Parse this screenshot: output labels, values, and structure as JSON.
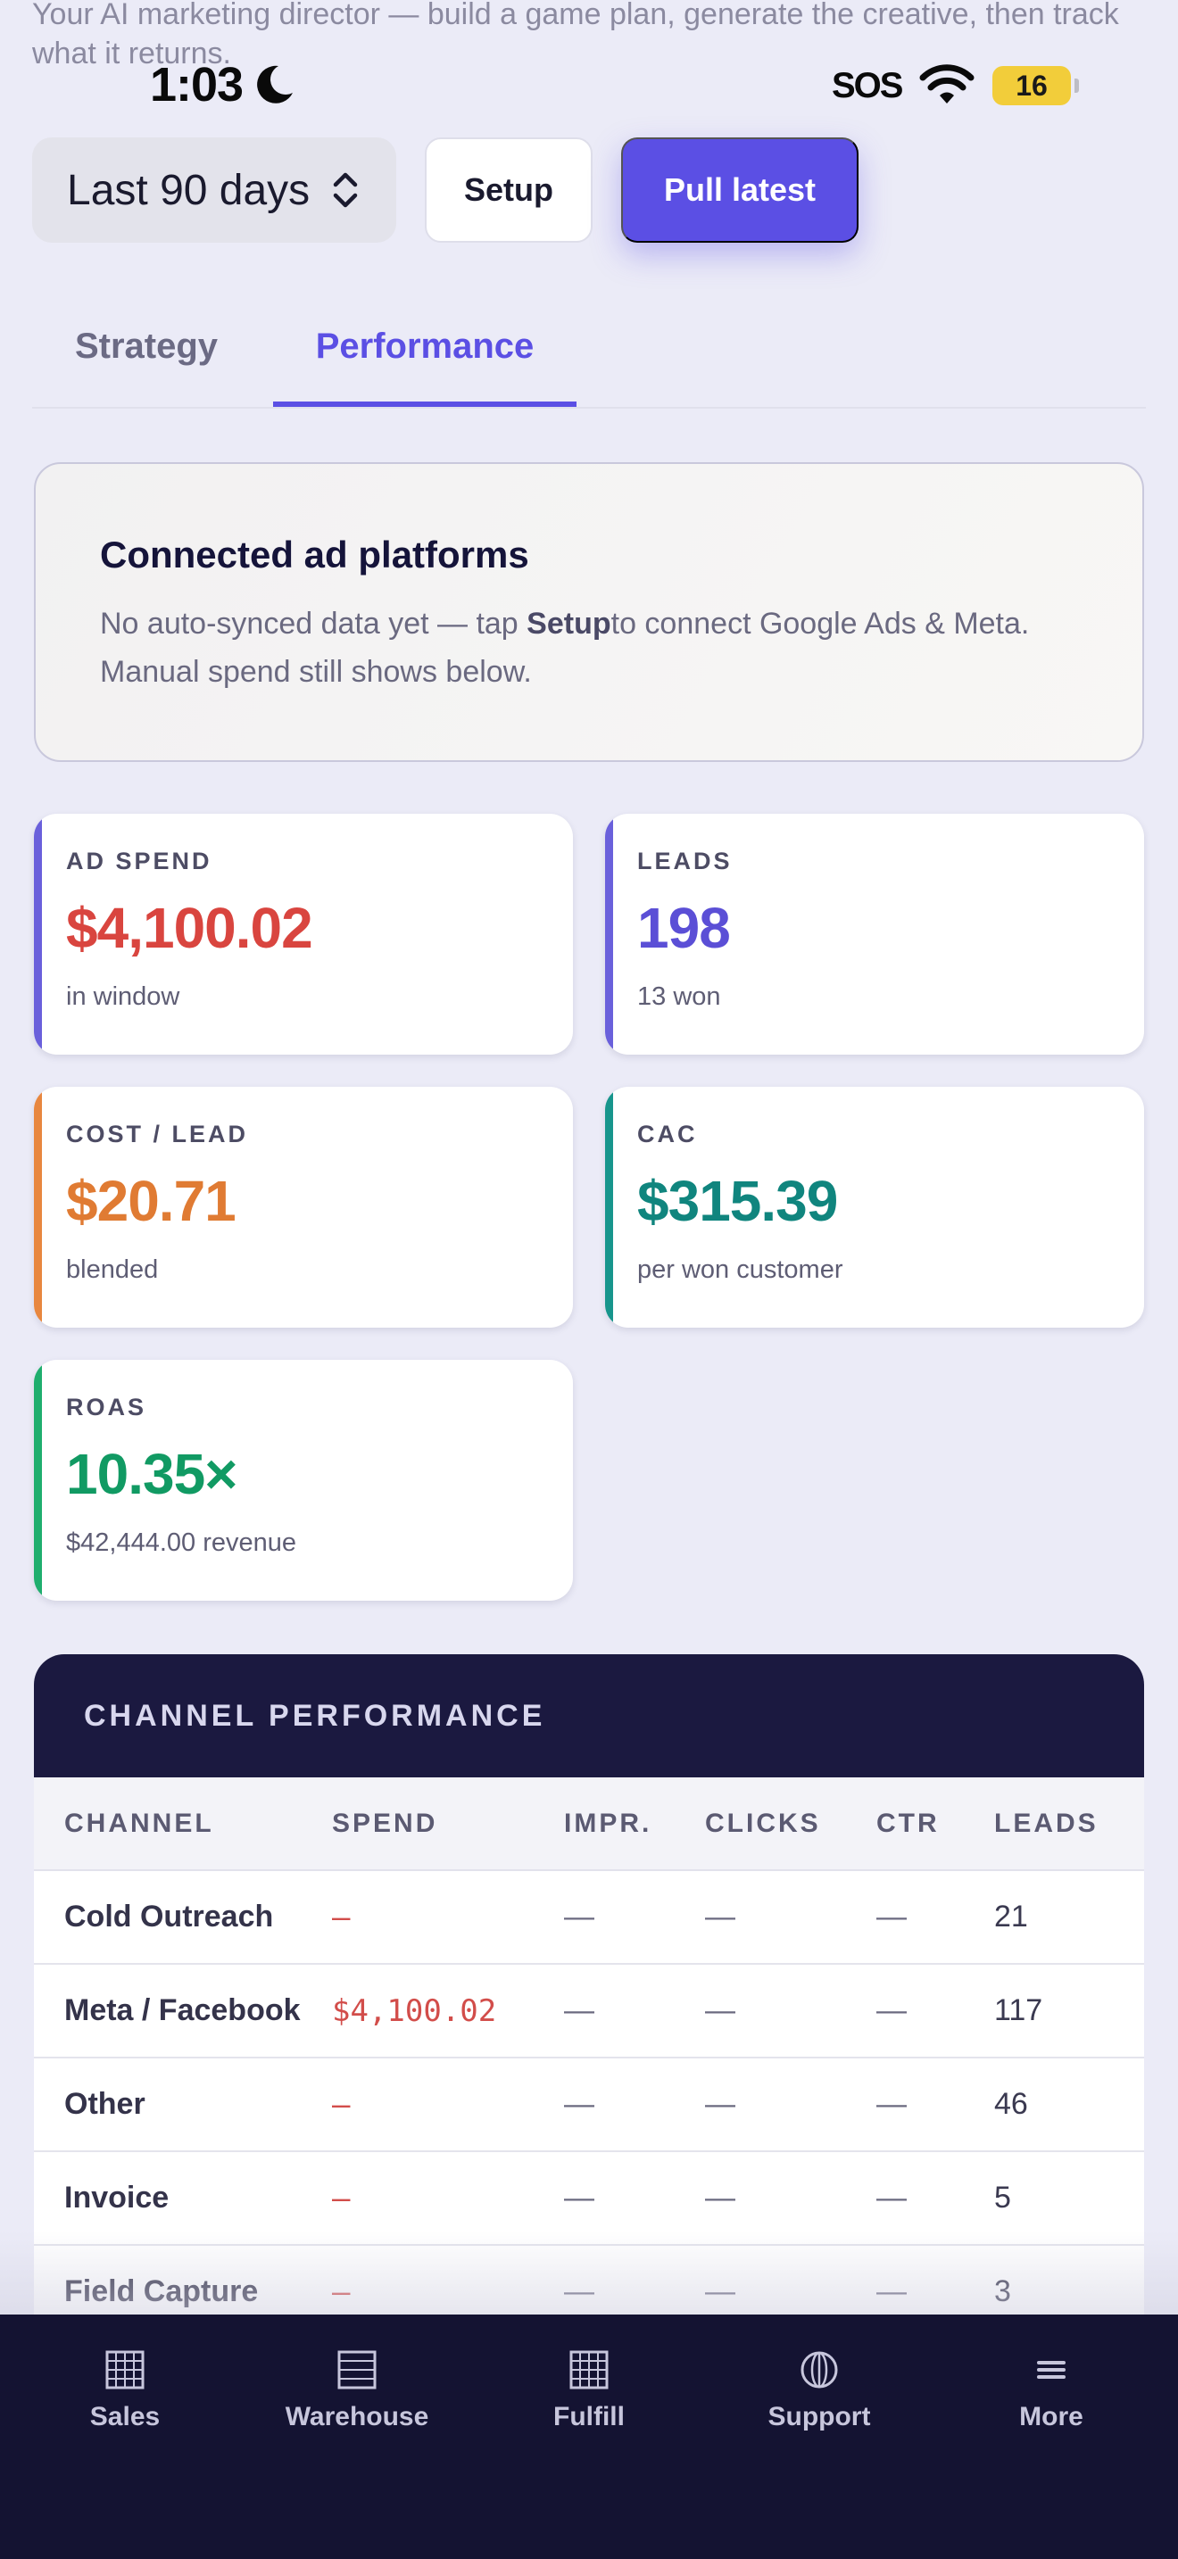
{
  "intro_text": "Your AI marketing director — build a game plan, generate the creative, then track what it returns.",
  "status_bar": {
    "time": "1:03",
    "carrier": "SOS",
    "battery": "16"
  },
  "controls": {
    "range_label": "Last 90 days",
    "setup_label": "Setup",
    "pull_label": "Pull latest"
  },
  "tabs": [
    {
      "label": "Strategy",
      "active": false
    },
    {
      "label": "Performance",
      "active": true
    }
  ],
  "connected": {
    "title": "Connected ad platforms",
    "body_before": "No auto-synced data yet — tap ",
    "body_bold": "Setup",
    "body_after": "to connect Google Ads & Meta. Manual spend still shows below."
  },
  "kpis": [
    {
      "label": "AD SPEND",
      "value": "$4,100.02",
      "sub": "in window",
      "value_color": "#d9453f",
      "accent": "#6a60db"
    },
    {
      "label": "LEADS",
      "value": "198",
      "sub": "13 won",
      "value_color": "#5b4fd6",
      "accent": "#6a60db"
    },
    {
      "label": "COST / LEAD",
      "value": "$20.71",
      "sub": "blended",
      "value_color": "#e07b33",
      "accent": "#e8873f"
    },
    {
      "label": "CAC",
      "value": "$315.39",
      "sub": "per won customer",
      "value_color": "#10857e",
      "accent": "#17958c"
    },
    {
      "label": "ROAS",
      "value": "10.35×",
      "sub": "$42,444.00 revenue",
      "value_color": "#119a63",
      "accent": "#1fae6e"
    }
  ],
  "channel_table": {
    "title": "CHANNEL PERFORMANCE",
    "columns": [
      "CHANNEL",
      "SPEND",
      "IMPR.",
      "CLICKS",
      "CTR",
      "LEADS"
    ],
    "rows": [
      {
        "channel": "Cold Outreach",
        "spend": "—",
        "impr": "—",
        "clicks": "—",
        "ctr": "—",
        "leads": "21"
      },
      {
        "channel": "Meta / Facebook",
        "spend": "$4,100.02",
        "impr": "—",
        "clicks": "—",
        "ctr": "—",
        "leads": "117"
      },
      {
        "channel": "Other",
        "spend": "—",
        "impr": "—",
        "clicks": "—",
        "ctr": "—",
        "leads": "46"
      },
      {
        "channel": "Invoice",
        "spend": "—",
        "impr": "—",
        "clicks": "—",
        "ctr": "—",
        "leads": "5"
      },
      {
        "channel": "Field Capture",
        "spend": "—",
        "impr": "—",
        "clicks": "—",
        "ctr": "—",
        "leads": "3"
      }
    ]
  },
  "bottom_nav": [
    {
      "label": "Sales",
      "icon": "grid-icon"
    },
    {
      "label": "Warehouse",
      "icon": "list-icon"
    },
    {
      "label": "Fulfill",
      "icon": "grid-icon"
    },
    {
      "label": "Support",
      "icon": "globe-icon"
    },
    {
      "label": "More",
      "icon": "menu-icon"
    }
  ],
  "colors": {
    "primary": "#5b4fe4",
    "navy": "#141332",
    "background": "#ebebf7"
  }
}
